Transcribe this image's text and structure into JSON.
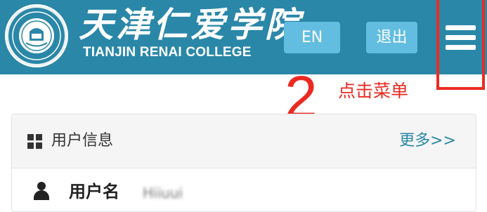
{
  "header": {
    "logo_cn": "天津仁爱学院",
    "logo_en": "TIANJIN RENAI COLLEGE",
    "lang_button": "EN",
    "logout_button": "退出",
    "menu_icon": "hamburger-menu-icon",
    "bg_color": "#2a87a8",
    "button_color": "#62bde0"
  },
  "annotation": {
    "step_number": "2",
    "step_text": "点击菜单",
    "color": "#ea2a21"
  },
  "panel": {
    "title_icon": "grid-icon",
    "title": "用户信息",
    "more_link": "更多>>",
    "field_icon": "user-icon",
    "field_label": "用户名",
    "field_value": "Hiiuui"
  }
}
